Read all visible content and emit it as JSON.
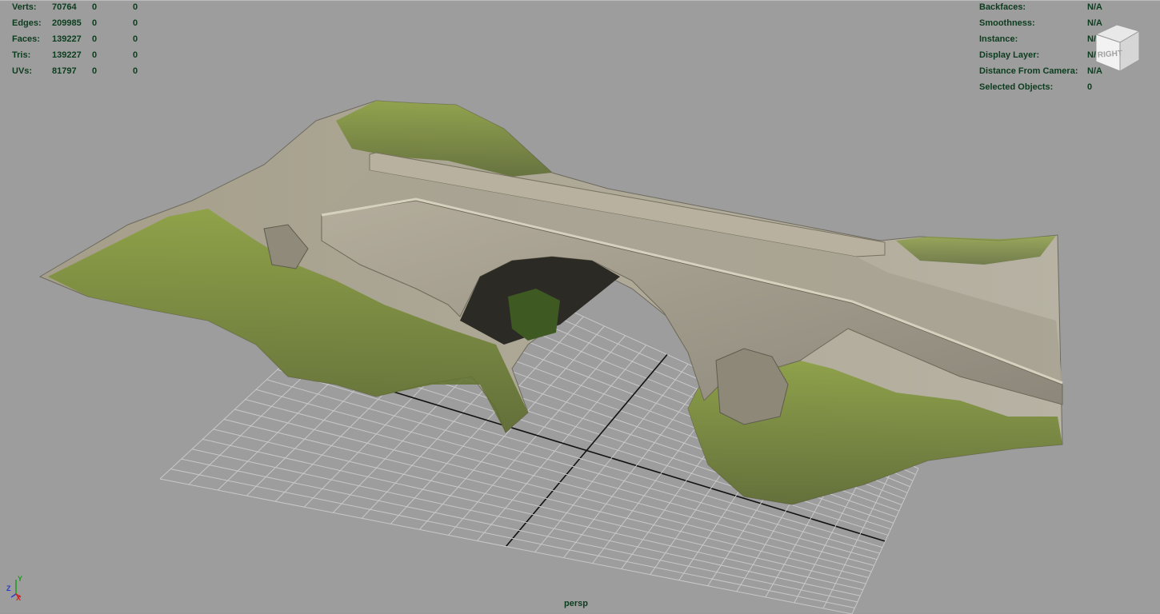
{
  "viewport": {
    "camera_label": "persp",
    "viewcube_label": "RIGHT"
  },
  "hud_left": [
    {
      "label": "Verts:",
      "total": "70764",
      "sel": "0",
      "comp": "0"
    },
    {
      "label": "Edges:",
      "total": "209985",
      "sel": "0",
      "comp": "0"
    },
    {
      "label": "Faces:",
      "total": "139227",
      "sel": "0",
      "comp": "0"
    },
    {
      "label": "Tris:",
      "total": "139227",
      "sel": "0",
      "comp": "0"
    },
    {
      "label": "UVs:",
      "total": "81797",
      "sel": "0",
      "comp": "0"
    }
  ],
  "hud_right": [
    {
      "label": "Backfaces:",
      "value": "N/A"
    },
    {
      "label": "Smoothness:",
      "value": "N/A"
    },
    {
      "label": "Instance:",
      "value": "N/A"
    },
    {
      "label": "Display Layer:",
      "value": "N/A"
    },
    {
      "label": "Distance From Camera:",
      "value": "N/A"
    },
    {
      "label": "Selected Objects:",
      "value": "0"
    }
  ],
  "axis": {
    "y": "Y",
    "z": "Z",
    "x": "X"
  },
  "colors": {
    "background": "#9d9d9d",
    "hud_text": "#0c3c1e",
    "grid_line": "#c8c8c8",
    "grid_axis": "#111111",
    "moss": "#6f8a2e",
    "stone": "#a59f8e"
  }
}
